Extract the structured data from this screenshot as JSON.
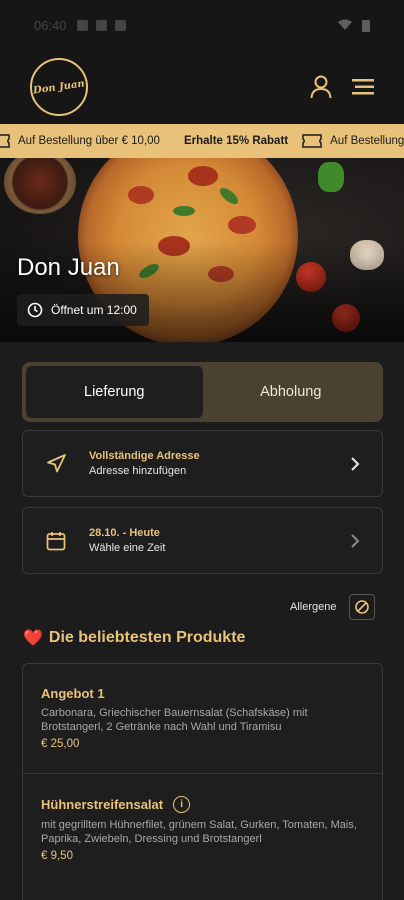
{
  "status_bar": {
    "time": "06:40"
  },
  "header": {
    "logo_text": "Don Juan",
    "icons": [
      "user-icon",
      "menu-icon"
    ]
  },
  "ticker": {
    "segments": [
      {
        "text": "Auf Bestellung über € 10,00",
        "bold": "Erhalte 15% Rabatt"
      },
      {
        "text": "Auf Bestellung",
        "bold": ""
      }
    ]
  },
  "hero": {
    "restaurant_name": "Don Juan",
    "open_text": "Öffnet um 12:00"
  },
  "delivery_toggle": {
    "options": [
      "Lieferung",
      "Abholung"
    ],
    "selected": "Lieferung"
  },
  "address_card": {
    "title": "Vollständige Adresse",
    "subtitle": "Adresse hinzufügen"
  },
  "time_card": {
    "title": "28.10. - Heute",
    "subtitle": "Wähle eine Zeit"
  },
  "allergene": {
    "label": "Allergene"
  },
  "section": {
    "emoji": "❤️",
    "title": "Die beliebtesten Produkte"
  },
  "products": [
    {
      "name": "Angebot 1",
      "description": "Carbonara, Griechischer Bauernsalat (Schafskäse) mit Brotstangerl, 2 Getränke nach Wahl und Tiramisu",
      "price": "€ 25,00",
      "has_info": false
    },
    {
      "name": "Hühnerstreifensalat",
      "description": "mit gegrilltem Hühnerfilet, grünem Salat, Gurken, Tomaten, Mais, Paprika, Zwiebeln, Dressing und Brotstangerl",
      "price": "€ 9,50",
      "has_info": true
    }
  ],
  "colors": {
    "accent": "#e8c27a",
    "background": "#1c1c1c",
    "card": "#1e1e1e",
    "toggle_bg": "#4a4130"
  }
}
